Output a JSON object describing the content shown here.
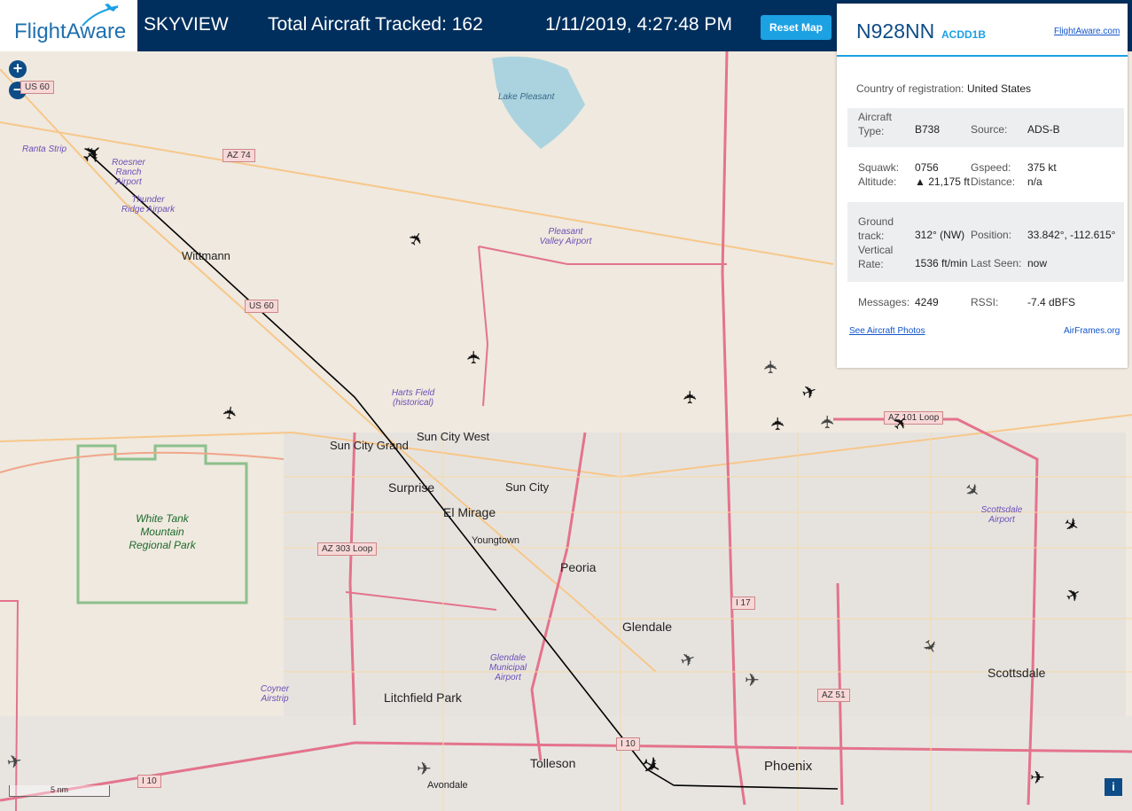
{
  "header": {
    "logo_text": "FlightAware",
    "app_title": "SKYVIEW",
    "total_tracked": "Total Aircraft Tracked: 162",
    "datetime": "1/11/2019, 4:27:48 PM",
    "reset_label": "Reset Map"
  },
  "map": {
    "zoom_in": "+",
    "zoom_out": "−",
    "scale_label": "5 nm",
    "info_button": "i",
    "cities": [
      "Wittmann",
      "Sun City Grand",
      "Sun City West",
      "Surprise",
      "Sun City",
      "El Mirage",
      "Youngtown",
      "Peoria",
      "Glendale",
      "Litchfield Park",
      "Tolleson",
      "Avondale",
      "Phoenix",
      "Scottsdale"
    ],
    "parks": [
      "White Tank Mountain Regional Park"
    ],
    "airports": [
      "Ranta Strip",
      "Roesner Ranch Airport",
      "Thunder Ridge Airpark",
      "Pleasant Valley Airport",
      "Harts Field (historical)",
      "Glendale Municipal Airport",
      "Coyner Airstrip",
      "Scottsdale Airport"
    ],
    "lake": "Lake Pleasant",
    "shields": [
      "US 60",
      "AZ 74",
      "US 60",
      "AZ 303 Loop",
      "I 17",
      "AZ 51",
      "I 10",
      "I 10",
      "AZ 101 Loop"
    ]
  },
  "info_panel": {
    "registration": "N928NN",
    "hex": "ACDD1B",
    "flightaware_link": "FlightAware.com",
    "country_label": "Country of registration:",
    "country_value": "United States",
    "aircraft_type_label": "Aircraft Type:",
    "aircraft_type_value": "B738",
    "source_label": "Source:",
    "source_value": "ADS-B",
    "squawk_label": "Squawk:",
    "squawk_value": "0756",
    "gspeed_label": "Gspeed:",
    "gspeed_value": "375 kt",
    "altitude_label": "Altitude:",
    "altitude_value": "▲ 21,175 ft",
    "distance_label": "Distance:",
    "distance_value": "n/a",
    "ground_track_label": "Ground track:",
    "ground_track_value": "312° (NW)",
    "position_label": "Position:",
    "position_value": "33.842°, -112.615°",
    "vrate_label": "Vertical Rate:",
    "vrate_value": "1536 ft/min",
    "last_seen_label": "Last Seen:",
    "last_seen_value": "now",
    "messages_label": "Messages:",
    "messages_value": "4249",
    "rssi_label": "RSSI:",
    "rssi_value": "-7.4 dBFS",
    "photos_link": "See Aircraft Photos",
    "airframes_link": "AirFrames.org"
  },
  "colors": {
    "header_bg": "#002f5d",
    "accent": "#1ca1e3",
    "freeway": "#e4738c",
    "track_line": "#000000"
  }
}
